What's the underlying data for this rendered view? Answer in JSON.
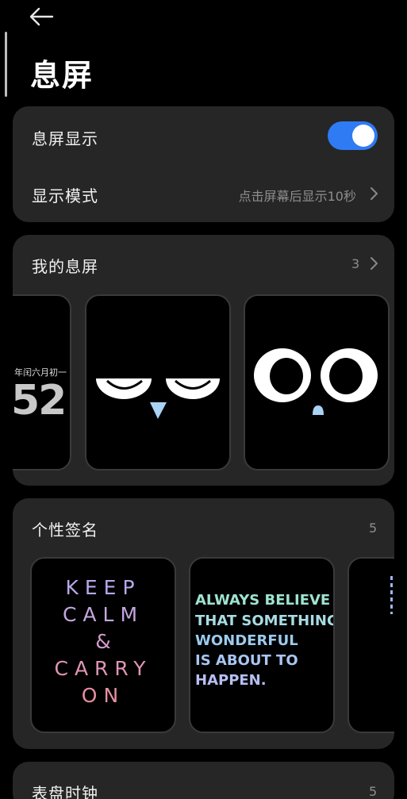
{
  "header": {
    "back_icon": "arrow-left-icon",
    "title": "息屏"
  },
  "aod_card": {
    "display_label": "息屏显示",
    "display_enabled": true,
    "mode_label": "显示模式",
    "mode_value": "点击屏幕后显示10秒",
    "accent": "#2f7bf4"
  },
  "my_aod": {
    "label": "我的息屏",
    "count": "3",
    "thumb1": {
      "date": "年闰六月初一",
      "time": "52"
    }
  },
  "signature": {
    "label": "个性签名",
    "count": "5",
    "thumb1": {
      "l1": "KEEP",
      "l2": "CALM",
      "l3": "&",
      "l4": "CARRY",
      "l5": "ON"
    },
    "thumb2": {
      "l1": "ALWAYS BELIEVE",
      "l2": "THAT SOMETHING",
      "l3": "WONDERFUL",
      "l4": "IS ABOUT TO",
      "l5": "HAPPEN."
    }
  },
  "clock": {
    "label": "表盘时钟",
    "count": "5"
  }
}
